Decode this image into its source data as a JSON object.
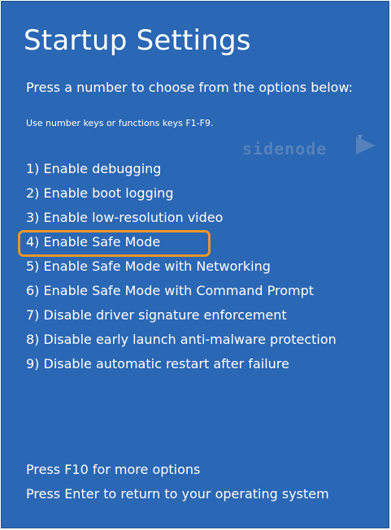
{
  "window": {
    "title": "Startup Settings",
    "instruction": "Press a number to choose from the options below:",
    "hint": "Use number keys or functions keys F1-F9."
  },
  "watermark": {
    "text": "sidenode"
  },
  "options": [
    {
      "label": "1) Enable debugging"
    },
    {
      "label": "2) Enable boot logging"
    },
    {
      "label": "3) Enable low-resolution video"
    },
    {
      "label": "4) Enable Safe Mode"
    },
    {
      "label": "5) Enable Safe Mode with Networking"
    },
    {
      "label": "6) Enable Safe Mode with Command Prompt"
    },
    {
      "label": "7) Disable driver signature enforcement"
    },
    {
      "label": "8) Disable early launch anti-malware protection"
    },
    {
      "label": "9) Disable automatic restart after failure"
    }
  ],
  "highlighted_option": "4) Enable Safe Mode",
  "footer": {
    "more_options": "Press F10 for more options",
    "return": "Press Enter to return to your operating system"
  },
  "colors": {
    "background": "#2a67b4",
    "text": "#ffffff",
    "highlight_border": "#e8962a"
  }
}
